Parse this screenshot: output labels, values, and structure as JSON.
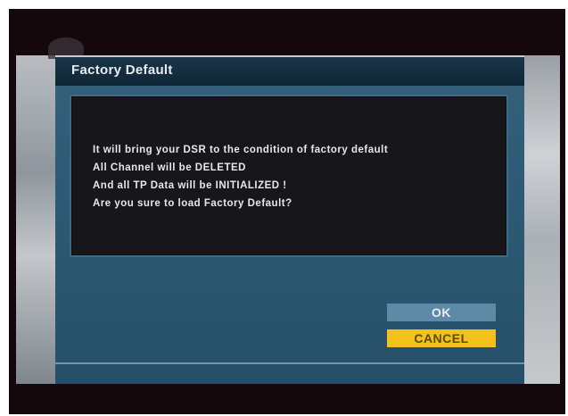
{
  "dialog": {
    "title": "Factory Default",
    "message_lines": [
      "It will bring your DSR to the condition of factory default",
      "All Channel will be DELETED",
      "And all TP Data will be INITIALIZED !",
      "Are you sure to load Factory Default?"
    ],
    "buttons": {
      "ok_label": "OK",
      "cancel_label": "CANCEL"
    }
  },
  "colors": {
    "screen_background": "#14080c",
    "dialog_body": "#2f5a75",
    "title_bar": "#1a3548",
    "message_panel": "#17161a",
    "ok_button": "#5d8aa6",
    "cancel_button_selected": "#f2c21a"
  },
  "icons": {
    "background_logo": "channel-logo-icon"
  }
}
